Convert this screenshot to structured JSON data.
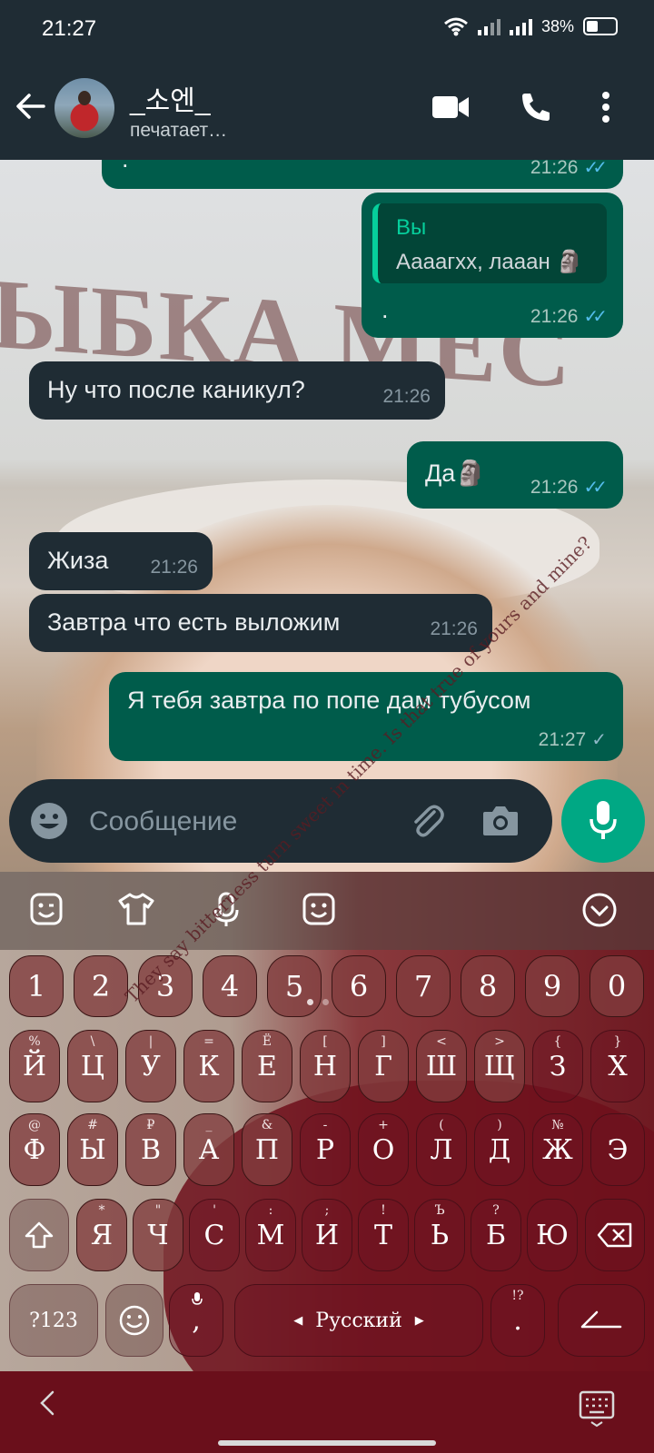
{
  "status_bar": {
    "time": "21:27",
    "battery": "38%"
  },
  "header": {
    "name": "_소엔_",
    "status": "печатает…"
  },
  "messages": [
    {
      "dir": "out",
      "text": ".",
      "time": "21:26",
      "ticks": "read"
    },
    {
      "dir": "out",
      "reply_author": "Вы",
      "reply_text": "Аааагхх, лааан 🗿",
      "text": ".",
      "time": "21:26",
      "ticks": "read"
    },
    {
      "dir": "in",
      "text": "Ну что после каникул?",
      "time": "21:26"
    },
    {
      "dir": "out",
      "text": "Да🗿",
      "time": "21:26",
      "ticks": "read"
    },
    {
      "dir": "in",
      "text": "Жиза",
      "time": "21:26"
    },
    {
      "dir": "in",
      "text": "Завтра что есть выложим",
      "time": "21:26"
    },
    {
      "dir": "out",
      "text": "Я тебя завтра по попе дам тубусом",
      "time": "21:27",
      "ticks": "sent"
    }
  ],
  "background": {
    "wall_text": "ЫБКА МЕС"
  },
  "composer": {
    "placeholder": "Сообщение"
  },
  "keyboard": {
    "numbers": [
      "1",
      "2",
      "3",
      "4",
      "5",
      "6",
      "7",
      "8",
      "9",
      "0"
    ],
    "row1": [
      {
        "k": "Й",
        "s": "%"
      },
      {
        "k": "Ц",
        "s": "\\"
      },
      {
        "k": "У",
        "s": "|"
      },
      {
        "k": "К",
        "s": "="
      },
      {
        "k": "Е",
        "s": "Ё"
      },
      {
        "k": "Н",
        "s": "["
      },
      {
        "k": "Г",
        "s": "]"
      },
      {
        "k": "Ш",
        "s": "<"
      },
      {
        "k": "Щ",
        "s": ">"
      },
      {
        "k": "З",
        "s": "{"
      },
      {
        "k": "Х",
        "s": "}"
      }
    ],
    "row2": [
      {
        "k": "Ф",
        "s": "@"
      },
      {
        "k": "Ы",
        "s": "#"
      },
      {
        "k": "В",
        "s": "₽"
      },
      {
        "k": "А",
        "s": "_"
      },
      {
        "k": "П",
        "s": "&"
      },
      {
        "k": "Р",
        "s": "-"
      },
      {
        "k": "О",
        "s": "+"
      },
      {
        "k": "Л",
        "s": "("
      },
      {
        "k": "Д",
        "s": ")"
      },
      {
        "k": "Ж",
        "s": "№"
      },
      {
        "k": "Э",
        "s": ""
      }
    ],
    "row3": [
      {
        "k": "Я",
        "s": "*"
      },
      {
        "k": "Ч",
        "s": "\""
      },
      {
        "k": "С",
        "s": "'"
      },
      {
        "k": "М",
        "s": ":"
      },
      {
        "k": "И",
        "s": ";"
      },
      {
        "k": "Т",
        "s": "!"
      },
      {
        "k": "Ь",
        "s": "Ъ"
      },
      {
        "k": "Б",
        "s": "?"
      },
      {
        "k": "Ю",
        "s": ""
      }
    ],
    "symbols_key": "?123",
    "comma_key": ",",
    "space_label": "Русский",
    "period_key": ".",
    "period_sub": "!?",
    "decor_text": "They say bitterness turn sweet in time. Is that true of yours and mine?"
  },
  "colors": {
    "incoming": "#1f2c34",
    "outgoing": "#005c4b",
    "accent": "#00a884",
    "read_ticks": "#53bdeb"
  }
}
